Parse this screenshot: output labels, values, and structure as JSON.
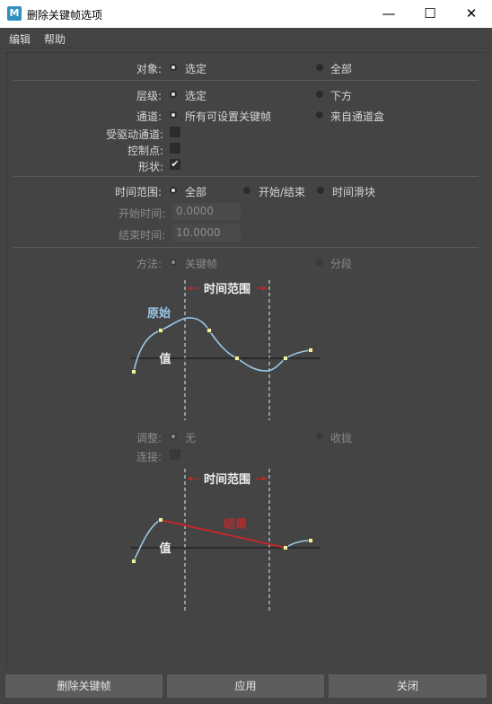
{
  "window": {
    "title": "删除关键帧选项",
    "app_icon": "M",
    "minimize": "—",
    "maximize": "☐",
    "close": "✕"
  },
  "menu": [
    "编辑",
    "帮助"
  ],
  "object": {
    "label": "对象:",
    "selected": "选定",
    "all": "全部"
  },
  "hierarchy": {
    "label": "层级:",
    "selected": "选定",
    "below": "下方"
  },
  "channels": {
    "label": "通道:",
    "all_keyable": "所有可设置关键帧",
    "from_channel_box": "来自通道盒"
  },
  "driven_channels": {
    "label": "受驱动通道:",
    "checked": false
  },
  "control_points": {
    "label": "控制点:",
    "checked": false
  },
  "shapes": {
    "label": "形状:",
    "checked": true
  },
  "time_range": {
    "label": "时间范围:",
    "all": "全部",
    "start_end": "开始/结束",
    "time_slider": "时间滑块"
  },
  "start_time": {
    "label": "开始时间:",
    "value": "0.0000"
  },
  "end_time": {
    "label": "结束时间:",
    "value": "10.0000"
  },
  "method": {
    "label": "方法:",
    "keys": "关键帧",
    "segments": "分段"
  },
  "diagram1": {
    "time_range": "时间范围",
    "original": "原始",
    "value": "值"
  },
  "adjust": {
    "label": "调整:",
    "none": "无",
    "collapse": "收拢"
  },
  "connect": {
    "label": "连接:",
    "checked": false
  },
  "diagram2": {
    "time_range": "时间范围",
    "result": "结果",
    "value": "值"
  },
  "buttons": {
    "delete": "删除关键帧",
    "apply": "应用",
    "close": "关闭"
  },
  "colors": {
    "curve": "#9ac8e8",
    "result": "#c0282c",
    "key_fill": "#f0f0a0"
  }
}
